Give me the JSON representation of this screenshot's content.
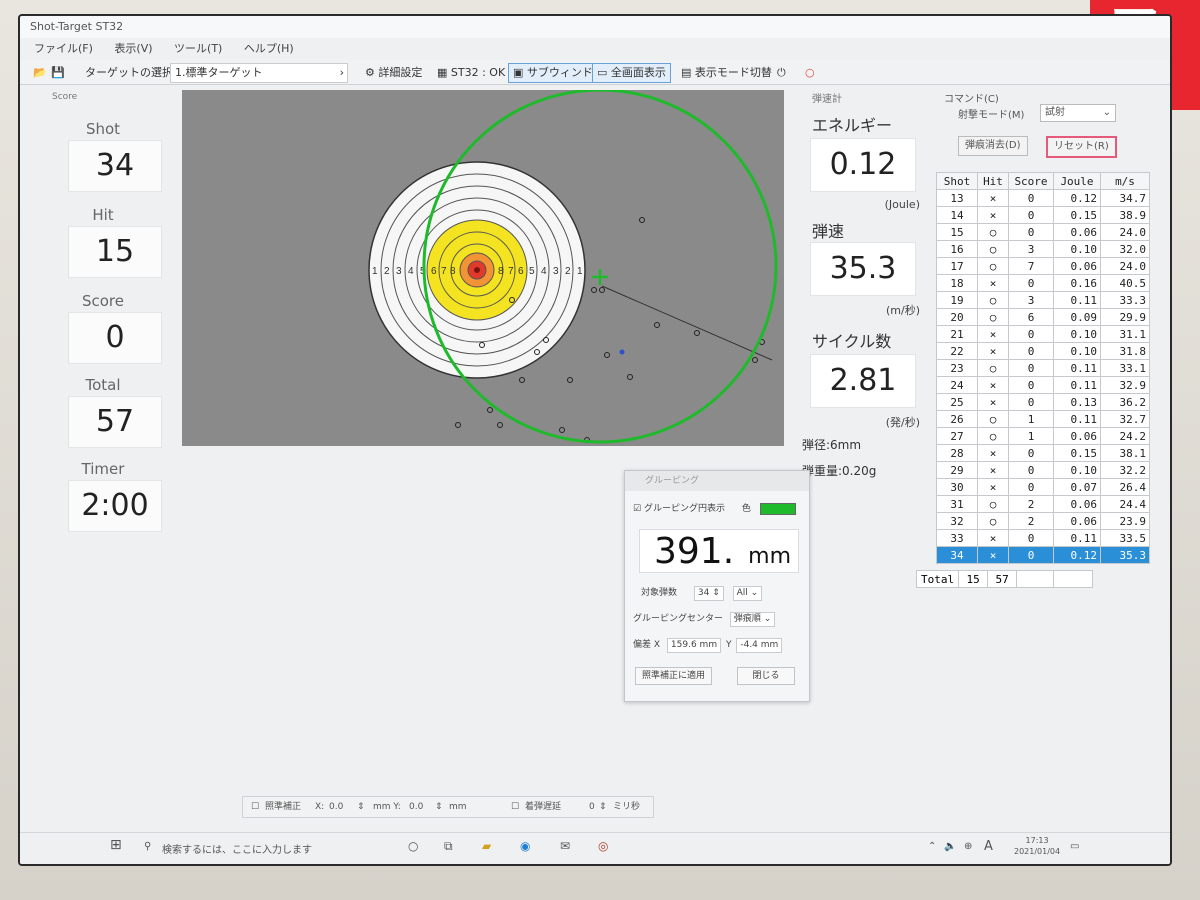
{
  "window": {
    "title": "Shot-Target ST32"
  },
  "menu": [
    "ファイル(F)",
    "表示(V)",
    "ツール(T)",
    "ヘルプ(H)"
  ],
  "toolbar": {
    "target_select_label": "ターゲットの選択:",
    "target_value": "1.標準ターゲット",
    "detail_settings": "詳細設定",
    "status": "ST32 : OK",
    "sub_window": "サブウィンドウ",
    "fullscreen": "全画面表示",
    "display_mode": "表示モード切替"
  },
  "score_panel": {
    "header": "Score",
    "shot_label": "Shot",
    "shot_value": "34",
    "hit_label": "Hit",
    "hit_value": "15",
    "score_label": "Score",
    "score_value": "0",
    "total_label": "Total",
    "total_value": "57",
    "timer_label": "Timer",
    "timer_value": "2:00"
  },
  "target": {
    "ring_numbers_left": [
      "1",
      "2",
      "3",
      "4",
      "5",
      "6",
      "7",
      "8"
    ],
    "ring_numbers_right": [
      "8",
      "7",
      "6",
      "5",
      "4",
      "3",
      "2",
      "1"
    ]
  },
  "ballistics": {
    "header": "弾速計",
    "energy_label": "エネルギー",
    "energy_value": "0.12",
    "energy_unit": "(Joule)",
    "velocity_label": "弾速",
    "velocity_value": "35.3",
    "velocity_unit": "(m/秒)",
    "cycle_label": "サイクル数",
    "cycle_value": "2.81",
    "cycle_unit": "(発/秒)",
    "caliber": "弾径:6mm",
    "weight": "弾重量:0.20g"
  },
  "command": {
    "header": "コマンド(C)",
    "fire_mode_label": "射撃モード(M)",
    "fire_mode_value": "試射",
    "clear_button": "弾痕消去(D)",
    "reset_button": "リセット(R)"
  },
  "shot_table": {
    "headers": [
      "Shot",
      "Hit",
      "Score",
      "Joule",
      "m/s"
    ],
    "rows": [
      [
        "13",
        "×",
        "0",
        "0.12",
        "34.7"
      ],
      [
        "14",
        "×",
        "0",
        "0.15",
        "38.9"
      ],
      [
        "15",
        "○",
        "0",
        "0.06",
        "24.0"
      ],
      [
        "16",
        "○",
        "3",
        "0.10",
        "32.0"
      ],
      [
        "17",
        "○",
        "7",
        "0.06",
        "24.0"
      ],
      [
        "18",
        "×",
        "0",
        "0.16",
        "40.5"
      ],
      [
        "19",
        "○",
        "3",
        "0.11",
        "33.3"
      ],
      [
        "20",
        "○",
        "6",
        "0.09",
        "29.9"
      ],
      [
        "21",
        "×",
        "0",
        "0.10",
        "31.1"
      ],
      [
        "22",
        "×",
        "0",
        "0.10",
        "31.8"
      ],
      [
        "23",
        "○",
        "0",
        "0.11",
        "33.1"
      ],
      [
        "24",
        "×",
        "0",
        "0.11",
        "32.9"
      ],
      [
        "25",
        "×",
        "0",
        "0.13",
        "36.2"
      ],
      [
        "26",
        "○",
        "1",
        "0.11",
        "32.7"
      ],
      [
        "27",
        "○",
        "1",
        "0.06",
        "24.2"
      ],
      [
        "28",
        "×",
        "0",
        "0.15",
        "38.1"
      ],
      [
        "29",
        "×",
        "0",
        "0.10",
        "32.2"
      ],
      [
        "30",
        "×",
        "0",
        "0.07",
        "26.4"
      ],
      [
        "31",
        "○",
        "2",
        "0.06",
        "24.4"
      ],
      [
        "32",
        "○",
        "2",
        "0.06",
        "23.9"
      ],
      [
        "33",
        "×",
        "0",
        "0.11",
        "33.5"
      ],
      [
        "34",
        "×",
        "0",
        "0.12",
        "35.3"
      ]
    ],
    "total_label": "Total",
    "total_hit": "15",
    "total_score": "57"
  },
  "grouping_dialog": {
    "title": "グルーピング",
    "show_circle_label": "グルーピング円表示",
    "color_label": "色",
    "color": "#1fba2b",
    "size_value": "391.",
    "size_unit": "mm",
    "target_shots_label": "対象弾数",
    "target_shots_value": "34",
    "target_scope": "All",
    "center_label": "グルーピングセンター",
    "center_value": "弾痕順",
    "offset_label": "偏差 X",
    "offset_x": "159.6",
    "offset_unit": "mm",
    "offset_y_label": "Y",
    "offset_y": "-4.4",
    "apply_button": "照準補正に適用",
    "close_button": "閉じる"
  },
  "bottom_bar": {
    "aim_correction": "照準補正",
    "x_label": "X:",
    "x_value": "0.0",
    "y_label": "mm Y:",
    "y_value": "0.0",
    "mm": "mm",
    "delay_label": "着弾遅延",
    "delay_value": "0",
    "delay_unit": "ミリ秒"
  },
  "taskbar": {
    "search_placeholder": "検索するには、ここに入力します",
    "time": "17:13",
    "date": "2021/01/04",
    "ime": "A"
  }
}
